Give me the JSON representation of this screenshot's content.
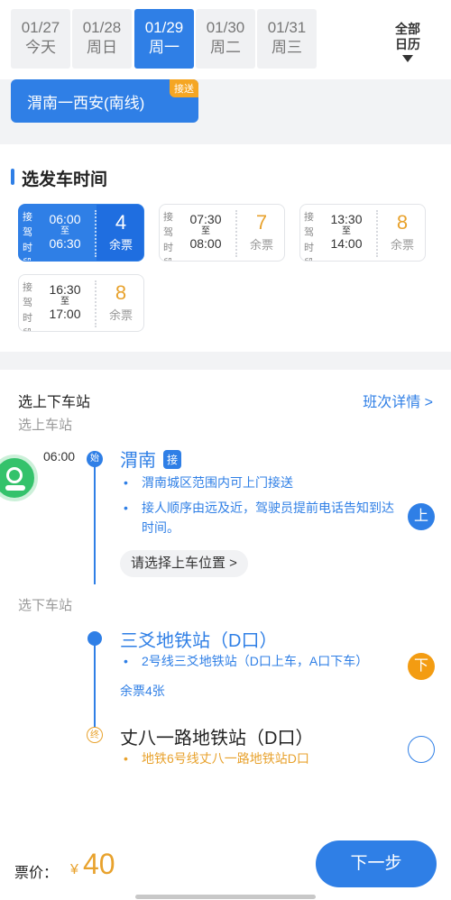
{
  "dates": [
    {
      "date": "01/27",
      "day": "今天",
      "selected": false
    },
    {
      "date": "01/28",
      "day": "周日",
      "selected": false
    },
    {
      "date": "01/29",
      "day": "周一",
      "selected": true
    },
    {
      "date": "01/30",
      "day": "周二",
      "selected": false
    },
    {
      "date": "01/31",
      "day": "周三",
      "selected": false
    }
  ],
  "calendar_label_1": "全部",
  "calendar_label_2": "日历",
  "route": {
    "name": "渭南一西安(南线)",
    "badge": "接送"
  },
  "departure": {
    "title": "选发车时间",
    "slot_tag": "接驾时段",
    "slot_sep": "至",
    "remaining_label": "余票",
    "slots": [
      {
        "start": "06:00",
        "end": "06:30",
        "remaining": "4",
        "selected": true
      },
      {
        "start": "07:30",
        "end": "08:00",
        "remaining": "7",
        "selected": false
      },
      {
        "start": "13:30",
        "end": "14:00",
        "remaining": "8",
        "selected": false
      },
      {
        "start": "16:30",
        "end": "17:00",
        "remaining": "8",
        "selected": false
      }
    ]
  },
  "stations": {
    "title": "选上下车站",
    "detail_link": "班次详情 >",
    "boarding_label": "选上车站",
    "alighting_label": "选下车站",
    "boarding_time": "06:00",
    "start_node": "始",
    "end_node": "终",
    "boarding": {
      "name": "渭南",
      "tag": "接",
      "notes": [
        "渭南城区范围内可上门接送",
        "接人顺序由远及近，驾驶员提前电话告知到达时间。"
      ],
      "pick_location": "请选择上车位置 >",
      "action": "上"
    },
    "alight_1": {
      "name": "三爻地铁站（D口）",
      "note": "2号线三爻地铁站（D口上车，A口下车）",
      "stock": "余票4张",
      "action": "下"
    },
    "alight_2": {
      "name": "丈八一路地铁站（D口）",
      "note": "地铁6号线丈八一路地铁站D口"
    }
  },
  "footer": {
    "price_label": "票价：",
    "currency": "¥",
    "price": "40",
    "next": "下一步"
  },
  "colors": {
    "primary": "#2f7fe6",
    "accent": "#e8a22d",
    "orange_btn": "#f39c12",
    "support": "#34c26b"
  }
}
